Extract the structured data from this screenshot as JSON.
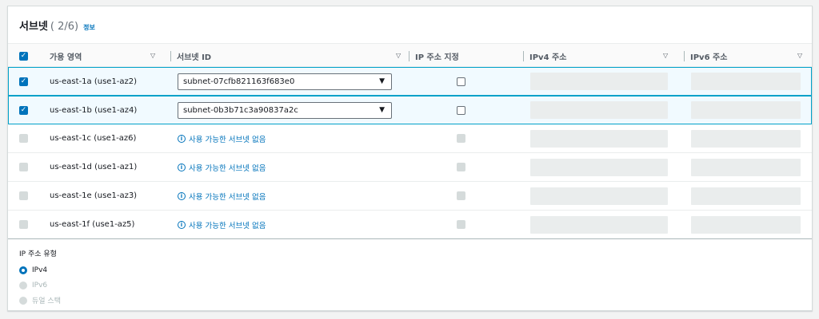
{
  "header": {
    "title": "서브넷",
    "count": "( 2/6)",
    "info_link": "정보"
  },
  "columns": {
    "az": "가용 영역",
    "subnet_id": "서브넷 ID",
    "ip_assign": "IP 주소 지정",
    "ipv4": "IPv4 주소",
    "ipv6": "IPv6 주소"
  },
  "rows": [
    {
      "az": "us-east-1a (use1-az2)",
      "subnet": "subnet-07cfb821163f683e0",
      "selected": true
    },
    {
      "az": "us-east-1b (use1-az4)",
      "subnet": "subnet-0b3b71c3a90837a2c",
      "selected": true
    },
    {
      "az": "us-east-1c (use1-az6)",
      "no_subnet": "사용 가능한 서브넷 없음",
      "selected": false
    },
    {
      "az": "us-east-1d (use1-az1)",
      "no_subnet": "사용 가능한 서브넷 없음",
      "selected": false
    },
    {
      "az": "us-east-1e (use1-az3)",
      "no_subnet": "사용 가능한 서브넷 없음",
      "selected": false
    },
    {
      "az": "us-east-1f (use1-az5)",
      "no_subnet": "사용 가능한 서브넷 없음",
      "selected": false
    }
  ],
  "ip_type": {
    "label": "IP 주소 유형",
    "options": [
      {
        "label": "IPv4",
        "state": "selected"
      },
      {
        "label": "IPv6",
        "state": "disabled"
      },
      {
        "label": "듀얼 스택",
        "state": "disabled"
      }
    ]
  },
  "icons": {
    "checkmark": "✓",
    "caret": "▽",
    "dropdown": "▼",
    "info": "i"
  },
  "colors": {
    "accent": "#0073bb",
    "selected_row_bg": "#f1faff",
    "selected_row_border": "#00a1c9"
  }
}
